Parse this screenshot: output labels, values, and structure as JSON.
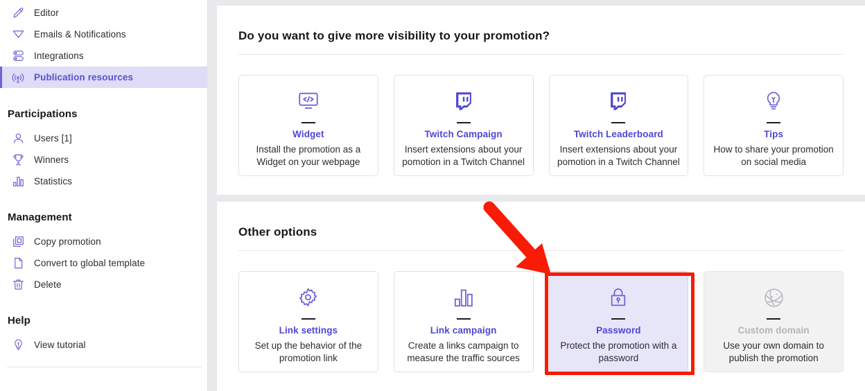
{
  "colors": {
    "accent": "#6c63d8",
    "accent_text": "#4f46d6",
    "active_bg": "#dedcf7",
    "annotation_red": "#f81b06",
    "page_bg": "#e9e9eb",
    "selected_card_bg": "#e7e5f8",
    "disabled_card_bg": "#f2f2f3"
  },
  "sidebar": {
    "nav_items": [
      {
        "label": "Editor",
        "icon": "pencil-icon",
        "active": false
      },
      {
        "label": "Emails & Notifications",
        "icon": "paper-plane-icon",
        "active": false
      },
      {
        "label": "Integrations",
        "icon": "server-stack-icon",
        "active": false
      },
      {
        "label": "Publication resources",
        "icon": "broadcast-antenna-icon",
        "active": true
      }
    ],
    "groups": [
      {
        "title": "Participations",
        "items": [
          {
            "label": "Users [1]",
            "icon": "user-icon"
          },
          {
            "label": "Winners",
            "icon": "trophy-icon"
          },
          {
            "label": "Statistics",
            "icon": "bar-chart-icon"
          }
        ]
      },
      {
        "title": "Management",
        "items": [
          {
            "label": "Copy promotion",
            "icon": "copy-icon"
          },
          {
            "label": "Convert to global template",
            "icon": "document-icon"
          },
          {
            "label": "Delete",
            "icon": "trash-icon"
          }
        ]
      },
      {
        "title": "Help",
        "items": [
          {
            "label": "View tutorial",
            "icon": "lightbulb-icon"
          }
        ]
      }
    ]
  },
  "panels": [
    {
      "heading": "Do you want to give more visibility to your promotion?",
      "cards": [
        {
          "icon": "code-monitor-icon",
          "title": "Widget",
          "description": "Install the promotion as a Widget on your webpage",
          "state": "default"
        },
        {
          "icon": "twitch-icon",
          "title": "Twitch Campaign",
          "description": "Insert extensions about your pomotion in a Twitch Channel",
          "state": "default"
        },
        {
          "icon": "twitch-icon",
          "title": "Twitch Leaderboard",
          "description": "Insert extensions about your pomotion in a Twitch Channel",
          "state": "default"
        },
        {
          "icon": "lightbulb-icon",
          "title": "Tips",
          "description": "How to share your promotion on social media",
          "state": "default"
        }
      ]
    },
    {
      "heading": "Other options",
      "cards": [
        {
          "icon": "gear-icon",
          "title": "Link settings",
          "description": "Set up the behavior of the promotion link",
          "state": "default"
        },
        {
          "icon": "bar-chart-icon",
          "title": "Link campaign",
          "description": "Create a links campaign to measure the traffic sources",
          "state": "default"
        },
        {
          "icon": "lock-icon",
          "title": "Password",
          "description": "Protect the promotion with a password",
          "state": "selected"
        },
        {
          "icon": "globe-icon",
          "title": "Custom domain",
          "description": "Use your own domain to publish the promotion",
          "state": "disabled"
        }
      ]
    }
  ],
  "annotations": {
    "arrow": {
      "label": "red-arrow-pointing-to-password-card"
    },
    "highlight_box": {
      "label": "red-highlight-box-around-password-card"
    }
  }
}
